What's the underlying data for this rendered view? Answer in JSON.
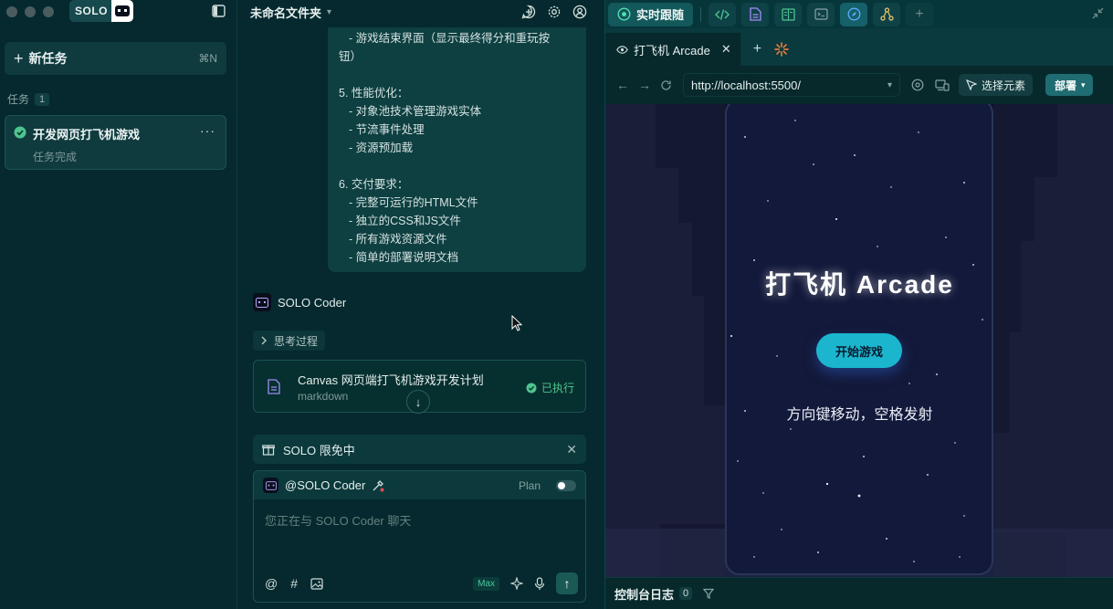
{
  "sidebar": {
    "logo_text": "SOLO",
    "new_task_label": "新任务",
    "new_task_shortcut": "⌘N",
    "tasks_header": "任务",
    "tasks_count": "1",
    "task": {
      "title": "开发网页打飞机游戏",
      "status": "任务完成",
      "more": "···"
    }
  },
  "chat": {
    "folder_name": "未命名文件夹",
    "message_lines": [
      {
        "text": "- 游戏结束界面（显示最终得分和重玩按",
        "indent": true
      },
      {
        "text": "钮）",
        "indent": false
      },
      {
        "text": "",
        "indent": false
      },
      {
        "text": "5. 性能优化：",
        "indent": false
      },
      {
        "text": "- 对象池技术管理游戏实体",
        "indent": true
      },
      {
        "text": "- 节流事件处理",
        "indent": true
      },
      {
        "text": "- 资源预加载",
        "indent": true
      },
      {
        "text": "",
        "indent": false
      },
      {
        "text": "6. 交付要求：",
        "indent": false
      },
      {
        "text": "- 完整可运行的HTML文件",
        "indent": true
      },
      {
        "text": "- 独立的CSS和JS文件",
        "indent": true
      },
      {
        "text": "- 所有游戏资源文件",
        "indent": true
      },
      {
        "text": "- 简单的部署说明文档",
        "indent": true
      }
    ],
    "agent_name": "SOLO Coder",
    "thinking_label": "思考过程",
    "plan_title": "Canvas 网页端打飞机游戏开发计划",
    "plan_type": "markdown",
    "plan_status": "已执行",
    "promo_label": "SOLO 限免中",
    "composer": {
      "agent_mention": "@SOLO Coder",
      "plan_label": "Plan",
      "placeholder": "您正在与 SOLO Coder 聊天",
      "max_label": "Max"
    }
  },
  "preview": {
    "live_label": "实时跟随",
    "tab_title": "打飞机 Arcade",
    "url": "http://localhost:5500/",
    "pick_element_label": "选择元素",
    "deploy_label": "部署",
    "game_title": "打飞机 Arcade",
    "start_button": "开始游戏",
    "hint": "方向键移动，空格发射",
    "console_label": "控制台日志",
    "console_count": "0"
  },
  "colors": {
    "background": "#05292e",
    "panel": "#0f3b3f",
    "accent": "#1bb6cd",
    "success": "#4fc48f"
  }
}
